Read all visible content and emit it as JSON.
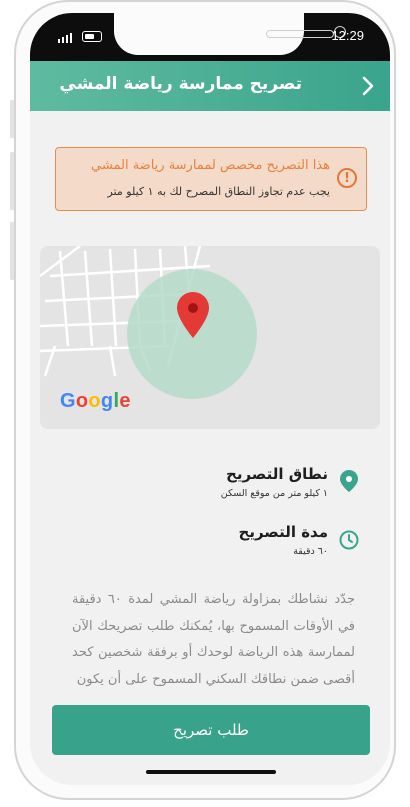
{
  "status_bar": {
    "time": "12:29"
  },
  "header": {
    "title": "تصريح ممارسة رياضة المشي"
  },
  "alert": {
    "title": "هذا التصريح مخصص لممارسة رياضة المشي",
    "subtitle": "يجب عدم تجاوز النطاق المصرح لك به ١ كيلو متر"
  },
  "map": {
    "provider_logo": "Google"
  },
  "permit_range": {
    "title": "نطاق التصريح",
    "value": "١ كيلو متر من موقع السكن"
  },
  "permit_duration": {
    "title": "مدة التصريح",
    "value": "٦٠ دقيقة"
  },
  "description": "جدّد نشاطك بمزاولة رياضة المشي لمدة ٦٠ دقيقة في الأوقات المسموح بها، يُمكنك طلب تصريحك الآن لممارسة هذه الرياضة لوحدك أو برفقة شخصين كحد أقصى ضمن نطاقك السكني المسموح على أن يكون",
  "actions": {
    "request_label": "طلب تصريح"
  },
  "colors": {
    "primary": "#38a28a",
    "alert_border": "#e88b4e",
    "alert_bg": "#f4dbc9",
    "pin": "#e53935"
  }
}
